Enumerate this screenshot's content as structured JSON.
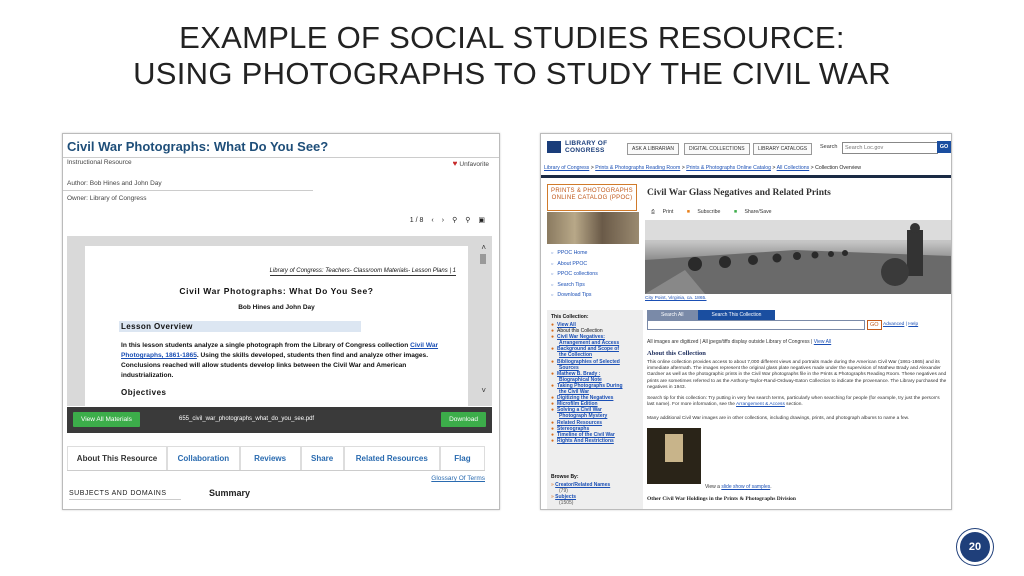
{
  "slide": {
    "title_line1": "EXAMPLE OF SOCIAL STUDIES RESOURCE:",
    "title_line2": "USING PHOTOGRAPHS TO STUDY THE CIVIL WAR",
    "page_number": "20"
  },
  "left_screenshot": {
    "title": "Civil War Photographs: What Do You See?",
    "resource_type": "Instructional Resource",
    "unfavorite_label": "Unfavorite",
    "author": "Author: Bob Hines and John Day",
    "owner": "Owner: Library of Congress",
    "page_counter": "1 / 8",
    "doc": {
      "header": "Library of Congress: Teachers- Classroom Materials- Lesson Plans | 1",
      "title": "Civil War Photographs: What Do You See?",
      "authors": "Bob Hines and John Day",
      "lesson_overview": "Lesson Overview",
      "para_pre": "In this lesson students analyze a single photograph from the Library of Congress collection ",
      "para_link": "Civil War Photographs, 1861-1865",
      "para_post": ". Using the skills developed, students then find and analyze other images. Conclusions reached will allow students develop links between the Civil War and American industrialization.",
      "objectives": "Objectives"
    },
    "view_all_label": "View All Materials",
    "pdf_name": "655_civil_war_photographs_what_do_you_see.pdf",
    "download_label": "Download",
    "tabs": [
      "About This Resource",
      "Collaboration",
      "Reviews",
      "Share",
      "Related Resources",
      "Flag"
    ],
    "glossary_label": "Glossary Of Terms",
    "subjects_label": "SUBJECTS AND DOMAINS",
    "summary_label": "Summary"
  },
  "right_screenshot": {
    "logo_line1": "LIBRARY OF",
    "logo_line2": "CONGRESS",
    "header_buttons": [
      "ASK A LIBRARIAN",
      "DIGITAL COLLECTIONS",
      "LIBRARY CATALOGS"
    ],
    "search_label": "Search",
    "search_placeholder": "Search Loc.gov",
    "go_label": "GO",
    "breadcrumb": {
      "items": [
        "Library of Congress",
        "Prints & Photographs Reading Room",
        "Prints & Photographs Online Catalog",
        "All Collections"
      ],
      "current": "Collection Overview",
      "sep": " > "
    },
    "ppoc_line1": "PRINTS & PHOTOGRAPHS",
    "ppoc_line2": "ONLINE CATALOG (PPOC)",
    "left_links": [
      "PPOC Home",
      "About PPOC",
      "PPOC collections",
      "Search Tips",
      "Download Tips"
    ],
    "main_title": "Civil War Glass Negatives and Related Prints",
    "tools": [
      "Print",
      "Subscribe",
      "Share/Save"
    ],
    "photo_caption": "City Point, Virginia, ca. 1865.",
    "this_collection_label": "This Collection:",
    "collection_links": [
      {
        "label": "View All",
        "link": true
      },
      {
        "label": "About this Collection",
        "link": false
      },
      {
        "label": "Civil War Negatives:",
        "link": true
      },
      {
        "label": "Arrangement and Access",
        "link": true,
        "sub": true
      },
      {
        "label": "Background and Scope of",
        "link": true
      },
      {
        "label": "the Collection",
        "link": true,
        "sub": true
      },
      {
        "label": "Bibliographies of Selected",
        "link": true
      },
      {
        "label": "Sources",
        "link": true,
        "sub": true
      },
      {
        "label": "Mathew B. Brady :",
        "link": true
      },
      {
        "label": "Biographical Note",
        "link": true,
        "sub": true
      },
      {
        "label": "Taking Photographs During",
        "link": true
      },
      {
        "label": "the Civil War",
        "link": true,
        "sub": true
      },
      {
        "label": "Digitizing the Negatives",
        "link": true
      },
      {
        "label": "Microfilm Edition",
        "link": true
      },
      {
        "label": "Solving a Civil War",
        "link": true
      },
      {
        "label": "Photograph Mystery",
        "link": true,
        "sub": true
      },
      {
        "label": "Related Resources",
        "link": true
      },
      {
        "label": "Stereographs",
        "link": true
      },
      {
        "label": "Timeline of the Civil War",
        "link": true
      },
      {
        "label": "Rights And Restrictions",
        "link": true
      }
    ],
    "browse_by_label": "Browse By:",
    "browse": [
      {
        "label": "Creator/Related Names",
        "count": "(79)"
      },
      {
        "label": "Subjects",
        "count": "(1505)"
      }
    ],
    "search_tabs": [
      "Search All",
      "Search This Collection"
    ],
    "go2_label": "GO",
    "advanced_label": "Advanced",
    "help_label": "Help",
    "digitized_text": "All images are digitized | All jpegs/tiffs display outside Library of Congress | ",
    "digitized_link": "View All",
    "about_heading": "About this Collection",
    "about_p1": "This online collection provides access to about 7,000 different views and portraits made during the American Civil War (1861-1865) and its immediate aftermath. The images represent the original glass plate negatives made under the supervision of Mathew Brady and Alexander Gardner as well as the photographic prints in the Civil War photographs file in the Prints & Photographs Reading Room. These negatives and prints are sometimes referred to as the Anthony-Taylor-Rand-Ordway-Eaton Collection to indicate the provenance. The Library purchased the negatives in 1943.",
    "about_p2_pre": "Search tip for this collection: Try putting in very few search terms, particularly when searching for people (for example, try just the person's last name). For more information, see the ",
    "about_p2_link": "Arrangement & Access",
    "about_p2_post": " section.",
    "about_p3": "Many additional Civil War images are in other collections, including drawings, prints, and photograph albums to name a few.",
    "slideshow_pre": "View a ",
    "slideshow_link": "slide show of samples",
    "slideshow_post": ".",
    "other_holdings": "Other Civil War Holdings in the Prints & Photographs Division"
  }
}
